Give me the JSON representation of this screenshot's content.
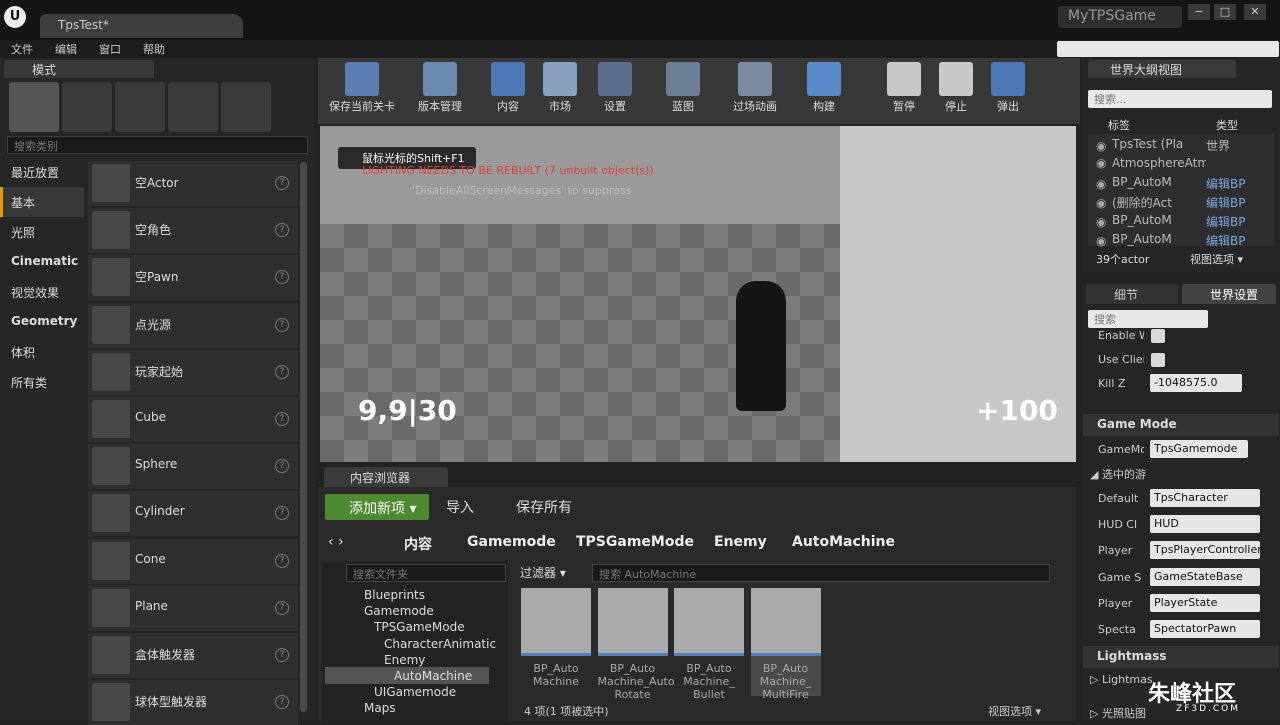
{
  "window": {
    "doc_tab": "TpsTest*",
    "app_title": "MyTPSGame",
    "minimize": "−",
    "maximize": "□",
    "close": "✕"
  },
  "menu": [
    "文件",
    "编辑",
    "窗口",
    "帮助"
  ],
  "modes": {
    "tab_label": "模式",
    "search_placeholder": "搜索类别",
    "mode_icons": [
      "place-mode-icon",
      "paint-mode-icon",
      "landscape-mode-icon",
      "foliage-mode-icon",
      "geometry-mode-icon"
    ],
    "categories": [
      {
        "label": "最近放置",
        "bold": false
      },
      {
        "label": "基本",
        "bold": false,
        "active": true
      },
      {
        "label": "光照",
        "bold": false
      },
      {
        "label": "Cinematic",
        "bold": true
      },
      {
        "label": "视觉效果",
        "bold": false
      },
      {
        "label": "Geometry",
        "bold": true
      },
      {
        "label": "体积",
        "bold": false
      },
      {
        "label": "所有类",
        "bold": false
      }
    ],
    "actors": [
      "空Actor",
      "空角色",
      "空Pawn",
      "点光源",
      "玩家起始",
      "Cube",
      "Sphere",
      "Cylinder",
      "Cone",
      "Plane",
      "盒体触发器",
      "球体型触发器"
    ]
  },
  "toolbar": [
    {
      "label": "保存当前关卡",
      "icon": "save-icon",
      "color": "#5b7fb5"
    },
    {
      "label": "版本管理",
      "icon": "source-control-icon",
      "color": "#6a8ab0"
    },
    {
      "label": "内容",
      "icon": "content-icon",
      "color": "#4c78b8"
    },
    {
      "label": "市场",
      "icon": "marketplace-icon",
      "color": "#8aa0c0"
    },
    {
      "label": "设置",
      "icon": "settings-icon",
      "color": "#5a6f8f"
    },
    {
      "label": "蓝图",
      "icon": "blueprint-icon",
      "color": "#6c7f95"
    },
    {
      "label": "过场动画",
      "icon": "cinematics-icon",
      "color": "#7a8aa0"
    },
    {
      "label": "构建",
      "icon": "build-icon",
      "color": "#5b8acb"
    },
    {
      "label": "暂停",
      "icon": "pause-icon",
      "color": "#c8c8c8"
    },
    {
      "label": "停止",
      "icon": "stop-icon",
      "color": "#c8c8c8"
    },
    {
      "label": "弹出",
      "icon": "eject-icon",
      "color": "#4c78b8"
    }
  ],
  "viewport": {
    "hint": "鼠标光标的Shift+F1",
    "warning": "LIGHTING NEEDS TO BE REBUILT (7 unbuilt object(s))",
    "suppress": "'DisableAllScreenMessages' to suppress",
    "ammo": "9,9|30",
    "health": "+100"
  },
  "content_browser": {
    "tab": "内容浏览器",
    "add_new": "添加新项 ▾",
    "import": "导入",
    "save_all": "保存所有",
    "breadcrumbs": [
      "内容",
      "Gamemode",
      "TPSGameMode",
      "Enemy",
      "AutoMachine"
    ],
    "folder_search_placeholder": "搜索文件夹",
    "filters_label": "过滤器 ▾",
    "asset_search_placeholder": "搜索 AutoMachine",
    "tree": [
      {
        "label": "Blueprints",
        "indent": 0
      },
      {
        "label": "Gamemode",
        "indent": 0
      },
      {
        "label": "TPSGameMode",
        "indent": 1
      },
      {
        "label": "CharacterAnimatic",
        "indent": 2
      },
      {
        "label": "Enemy",
        "indent": 2
      },
      {
        "label": "AutoMachine",
        "indent": 3
      },
      {
        "label": "UIGamemode",
        "indent": 1
      },
      {
        "label": "Maps",
        "indent": 0
      }
    ],
    "assets": [
      {
        "label": "BP_Auto Machine",
        "selected": false
      },
      {
        "label": "BP_Auto Machine_Auto Rotate",
        "selected": false
      },
      {
        "label": "BP_Auto Machine_ Bullet",
        "selected": false
      },
      {
        "label": "BP_Auto Machine_ MultiFire",
        "selected": true
      }
    ],
    "count": "4 项(1 项被选中)",
    "view_options": "视图选项 ▾"
  },
  "outliner": {
    "tab": "世界大纲视图",
    "search_placeholder": "搜索...",
    "col_label": "标签",
    "col_type": "类型",
    "rows": [
      {
        "label": "TpsTest (Pla",
        "type": "世界",
        "link": false
      },
      {
        "label": "AtmosphereAtmosp",
        "type": "",
        "link": false
      },
      {
        "label": "BP_AutoM",
        "type": "编辑BP",
        "link": true
      },
      {
        "label": "(删除的Act",
        "type": "编辑BP",
        "link": true
      },
      {
        "label": "BP_AutoM",
        "type": "编辑BP",
        "link": true
      },
      {
        "label": "BP_AutoM",
        "type": "编辑BP",
        "link": true
      }
    ],
    "count": "39个actor",
    "view_options": "视图选项 ▾"
  },
  "details": {
    "tab_details": "细节",
    "tab_world": "世界设置",
    "search_placeholder": "搜索",
    "enable_label": "Enable W",
    "use_client_label": "Use Clier",
    "kill_z_label": "Kill Z",
    "kill_z_value": "-1048575.0",
    "game_mode_section": "Game Mode",
    "game_mode_label": "GameMo",
    "game_mode_value": "TpsGamemode",
    "selected_section": "◢ 选中的游",
    "props": [
      {
        "label": "Default",
        "value": "TpsCharacter"
      },
      {
        "label": "HUD Cl",
        "value": "HUD"
      },
      {
        "label": "Player",
        "value": "TpsPlayerController"
      },
      {
        "label": "Game S",
        "value": "GameStateBase"
      },
      {
        "label": "Player",
        "value": "PlayerState"
      },
      {
        "label": "Specta",
        "value": "SpectatorPawn"
      }
    ],
    "lightmass_section": "Lightmass",
    "lightmass_sub": "▷ Lightmas",
    "lightmap_sub": "▷ 光照贴图"
  },
  "watermark": {
    "text": "朱峰社区",
    "sub": "ZF3D.COM"
  }
}
